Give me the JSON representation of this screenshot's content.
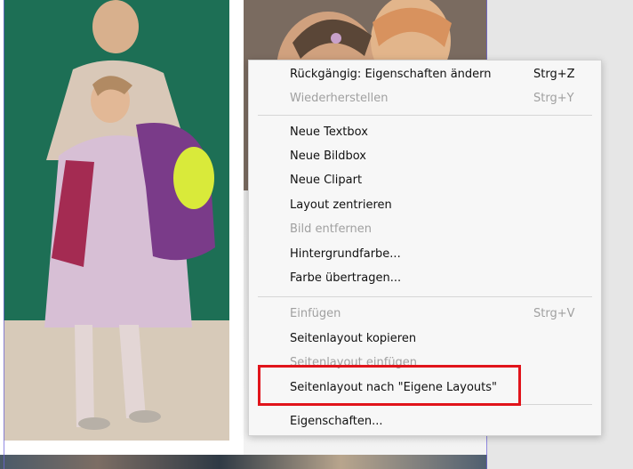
{
  "context_menu": {
    "items": [
      {
        "label": "Rückgängig: Eigenschaften ändern",
        "shortcut": "Strg+Z",
        "enabled": true
      },
      {
        "label": "Wiederherstellen",
        "shortcut": "Strg+Y",
        "enabled": false
      },
      {
        "label": "Neue Textbox",
        "shortcut": "",
        "enabled": true
      },
      {
        "label": "Neue Bildbox",
        "shortcut": "",
        "enabled": true
      },
      {
        "label": "Neue Clipart",
        "shortcut": "",
        "enabled": true
      },
      {
        "label": "Layout zentrieren",
        "shortcut": "",
        "enabled": true
      },
      {
        "label": "Bild entfernen",
        "shortcut": "",
        "enabled": false
      },
      {
        "label": "Hintergrundfarbe...",
        "shortcut": "",
        "enabled": true
      },
      {
        "label": "Farbe übertragen...",
        "shortcut": "",
        "enabled": true
      },
      {
        "label": "Einfügen",
        "shortcut": "Strg+V",
        "enabled": false
      },
      {
        "label": "Seitenlayout kopieren",
        "shortcut": "",
        "enabled": true
      },
      {
        "label": "Seitenlayout einfügen",
        "shortcut": "",
        "enabled": false
      },
      {
        "label": "Seitenlayout nach \"Eigene Layouts\"",
        "shortcut": "",
        "enabled": true
      },
      {
        "label": "Eigenschaften...",
        "shortcut": "",
        "enabled": true
      }
    ]
  },
  "colors": {
    "highlight_border": "#e1141b",
    "disabled_text": "#a0a0a0",
    "menu_background": "#f7f7f7"
  }
}
